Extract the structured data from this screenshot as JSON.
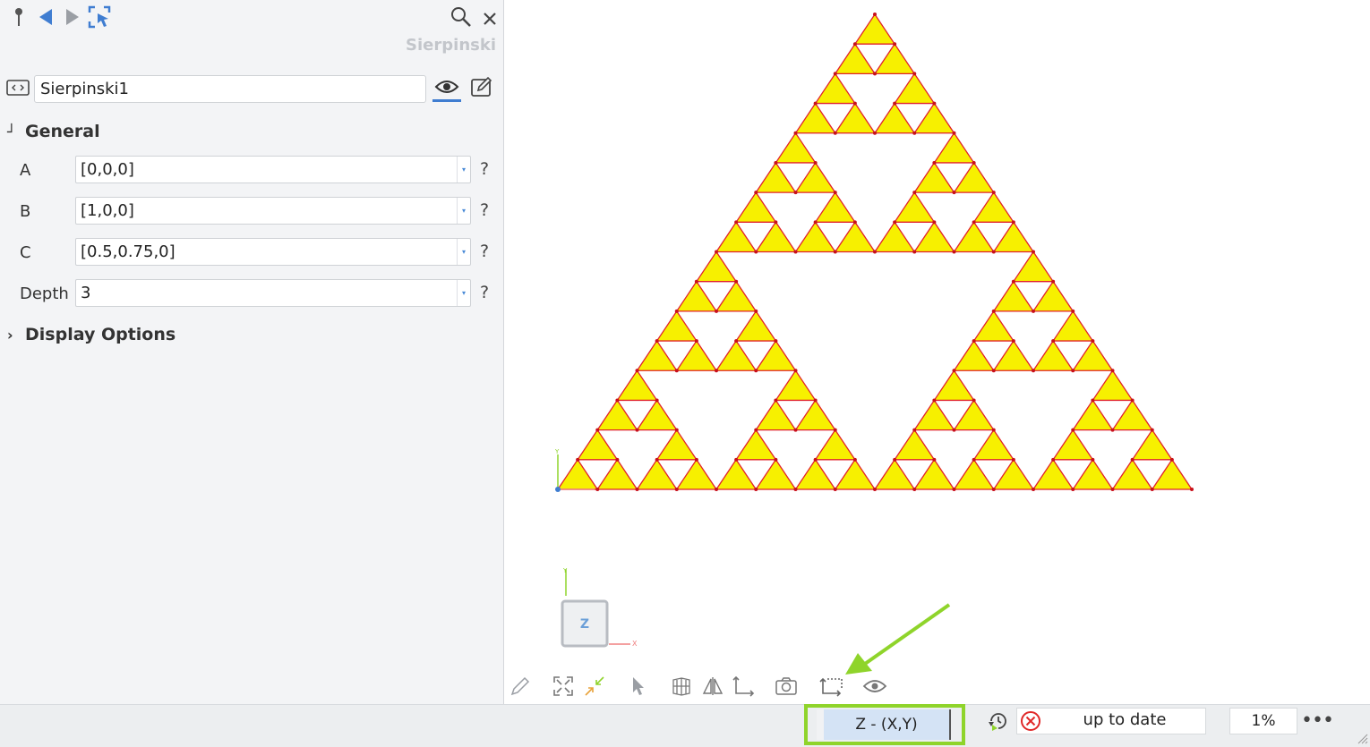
{
  "panel": {
    "title": "Sierpinski",
    "object_name": "Sierpinski1",
    "icons": [
      "pin-icon",
      "back-arrow-icon",
      "forward-arrow-icon",
      "select-pick-icon",
      "search-icon",
      "close-icon",
      "script-object-icon",
      "eye-icon",
      "edit-icon"
    ],
    "sections": {
      "general": "General",
      "display_options": "Display Options"
    },
    "properties": [
      {
        "label": "A",
        "value": "[0,0,0]",
        "help": "?"
      },
      {
        "label": "B",
        "value": "[1,0,0]",
        "help": "?"
      },
      {
        "label": "C",
        "value": "[0.5,0.75,0]",
        "help": "?"
      },
      {
        "label": "Depth",
        "value": "3",
        "help": "?"
      }
    ]
  },
  "viewport": {
    "fractal_depth": 3,
    "fill_color": "#f7f000",
    "edge_color": "#e0202a",
    "axes": {
      "x": "X",
      "y": "Y"
    },
    "navcube_face": "Z"
  },
  "toolbar": {
    "icons": [
      "pencil-icon",
      "zoom-extents-icon",
      "zoom-selection-icon",
      "pointer-icon",
      "grid-icon",
      "mirror-icon",
      "axes-icon",
      "camera-icon",
      "view-plane-icon",
      "eye-icon"
    ]
  },
  "status": {
    "view_label": "Z - (X,Y)",
    "recompute_status": "up to date",
    "progress": "1%",
    "more": "•••"
  },
  "colors": {
    "accent": "#3f7dd1",
    "highlight": "#8fd42b",
    "view_label_bg": "#d4e3f5"
  }
}
